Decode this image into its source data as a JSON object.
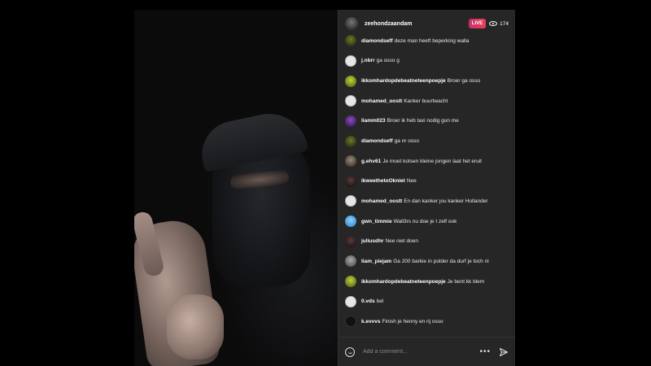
{
  "stream": {
    "username": "zeehondzaandam",
    "live_label": "LIVE",
    "viewer_count": "174"
  },
  "comments": [
    {
      "user": "diamondseff",
      "text": "deze man heeft beperking walla",
      "avatar": "leaf"
    },
    {
      "user": "j.nbrr",
      "text": "ga osso g",
      "avatar": "white"
    },
    {
      "user": "ikkomhardopdebeatneteenpoepje",
      "text": "Broer ga osso",
      "avatar": "green"
    },
    {
      "user": "mohamed_oostt",
      "text": "Kanker buurtwacht",
      "avatar": "white"
    },
    {
      "user": "liamm023",
      "text": "Broer ik heb taxi nodig gun me",
      "avatar": "purple"
    },
    {
      "user": "diamondseff",
      "text": "ga nr osso",
      "avatar": "leaf"
    },
    {
      "user": "g.ehv61",
      "text": "Je moet kotsen kleine jongen laat het eruit",
      "avatar": "brown"
    },
    {
      "user": "ikweethetoOkniet",
      "text": "Nee",
      "avatar": "dark"
    },
    {
      "user": "mohamed_oostt",
      "text": "En dan kanker jou kanker Hollander",
      "avatar": "white"
    },
    {
      "user": "gwn_timmie",
      "text": "Wall3rs nu doe je t zelf ook",
      "avatar": "blue"
    },
    {
      "user": "juliusdhr",
      "text": "Nee niet doen",
      "avatar": "dark"
    },
    {
      "user": "liam_piejam",
      "text": "Ga 200 barkie in polder da durf je toch ni",
      "avatar": "photo"
    },
    {
      "user": "ikkomhardopdebeatneteenpoepje",
      "text": "Je bent kk blem",
      "avatar": "green"
    },
    {
      "user": "0.vds",
      "text": "bel",
      "avatar": "white"
    },
    {
      "user": "k.evvvs",
      "text": "Finish je henny en rij osso",
      "avatar": "black"
    }
  ],
  "input": {
    "placeholder": "Add a comment..."
  },
  "icons": {
    "viewers": "eye-icon",
    "emoji": "smile-icon",
    "more": "more-icon",
    "send": "send-icon"
  },
  "colors": {
    "panel_bg": "#262626",
    "live_badge": "#e84057"
  }
}
